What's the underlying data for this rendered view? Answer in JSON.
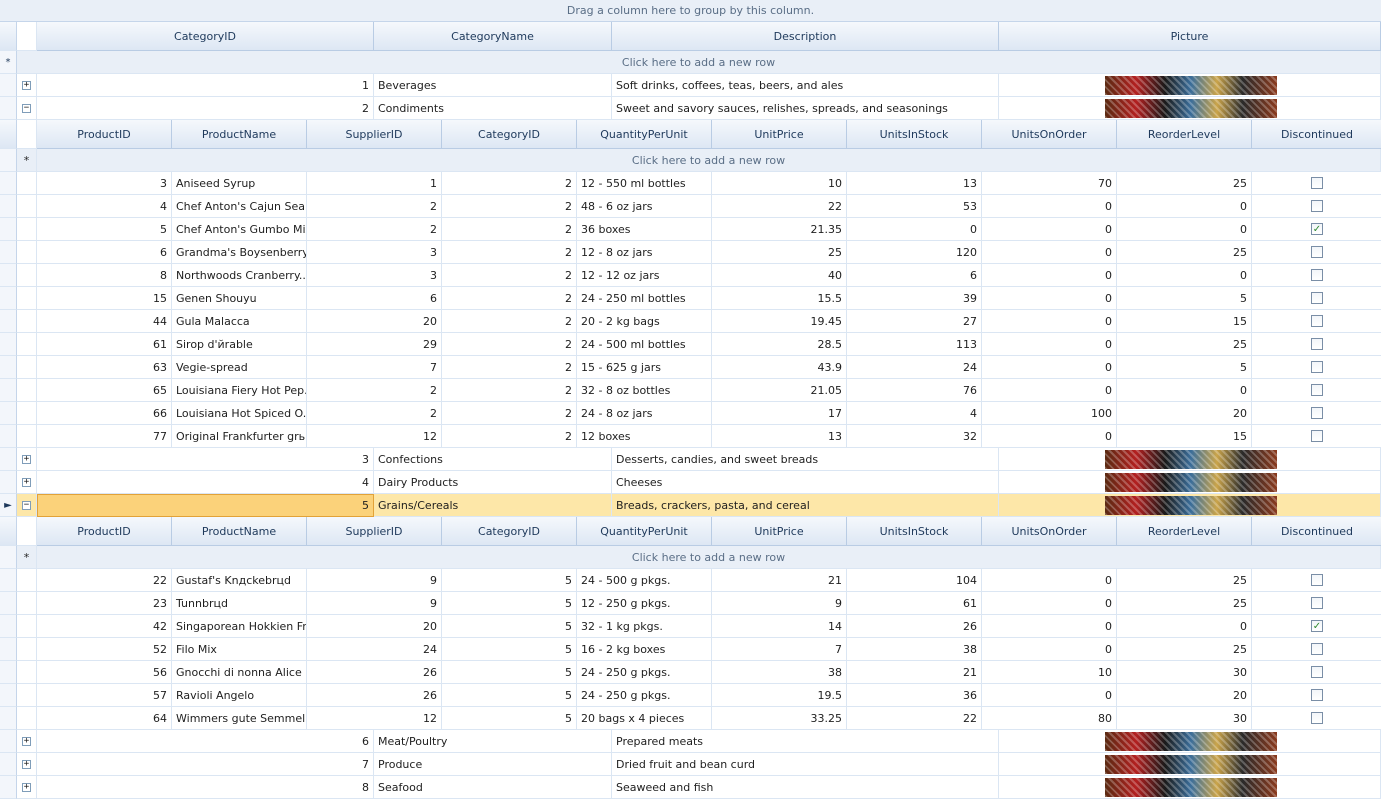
{
  "group_panel": "Drag a column here to group by this column.",
  "new_row_text": "Click here to add a new row",
  "new_row_icon": "*",
  "current_row_icon": "►",
  "master_columns": [
    "CategoryID",
    "CategoryName",
    "Description",
    "Picture"
  ],
  "detail_columns": [
    "ProductID",
    "ProductName",
    "SupplierID",
    "CategoryID",
    "QuantityPerUnit",
    "UnitPrice",
    "UnitsInStock",
    "UnitsOnOrder",
    "ReorderLevel",
    "Discontinued"
  ],
  "categories": [
    {
      "id": "1",
      "name": "Beverages",
      "description": "Soft drinks, coffees, teas, beers, and ales",
      "expanded": false
    },
    {
      "id": "2",
      "name": "Condiments",
      "description": "Sweet and savory sauces, relishes, spreads, and seasonings",
      "expanded": true
    },
    {
      "id": "3",
      "name": "Confections",
      "description": "Desserts, candies, and sweet breads",
      "expanded": false
    },
    {
      "id": "4",
      "name": "Dairy Products",
      "description": "Cheeses",
      "expanded": false
    },
    {
      "id": "5",
      "name": "Grains/Cereals",
      "description": "Breads, crackers, pasta, and cereal",
      "expanded": true,
      "selected": true
    },
    {
      "id": "6",
      "name": "Meat/Poultry",
      "description": "Prepared meats",
      "expanded": false
    },
    {
      "id": "7",
      "name": "Produce",
      "description": "Dried fruit and bean curd",
      "expanded": false
    },
    {
      "id": "8",
      "name": "Seafood",
      "description": "Seaweed and fish",
      "expanded": false
    }
  ],
  "condiments_products": [
    [
      "3",
      "Aniseed Syrup",
      "1",
      "2",
      "12 - 550 ml bottles",
      "10",
      "13",
      "70",
      "25",
      false
    ],
    [
      "4",
      "Chef Anton's Cajun Sea...",
      "2",
      "2",
      "48 - 6 oz jars",
      "22",
      "53",
      "0",
      "0",
      false
    ],
    [
      "5",
      "Chef Anton's Gumbo Mix",
      "2",
      "2",
      "36 boxes",
      "21.35",
      "0",
      "0",
      "0",
      true
    ],
    [
      "6",
      "Grandma's Boysenberry...",
      "3",
      "2",
      "12 - 8 oz jars",
      "25",
      "120",
      "0",
      "25",
      false
    ],
    [
      "8",
      "Northwoods Cranberry...",
      "3",
      "2",
      "12 - 12 oz jars",
      "40",
      "6",
      "0",
      "0",
      false
    ],
    [
      "15",
      "Genen Shouyu",
      "6",
      "2",
      "24 - 250 ml bottles",
      "15.5",
      "39",
      "0",
      "5",
      false
    ],
    [
      "44",
      "Gula Malacca",
      "20",
      "2",
      "20 - 2 kg bags",
      "19.45",
      "27",
      "0",
      "15",
      false
    ],
    [
      "61",
      "Sirop d'йrable",
      "29",
      "2",
      "24 - 500 ml bottles",
      "28.5",
      "113",
      "0",
      "25",
      false
    ],
    [
      "63",
      "Vegie-spread",
      "7",
      "2",
      "15 - 625 g jars",
      "43.9",
      "24",
      "0",
      "5",
      false
    ],
    [
      "65",
      "Louisiana Fiery Hot Pep...",
      "2",
      "2",
      "32 - 8 oz bottles",
      "21.05",
      "76",
      "0",
      "0",
      false
    ],
    [
      "66",
      "Louisiana Hot Spiced O...",
      "2",
      "2",
      "24 - 8 oz jars",
      "17",
      "4",
      "100",
      "20",
      false
    ],
    [
      "77",
      "Original Frankfurter grь...",
      "12",
      "2",
      "12 boxes",
      "13",
      "32",
      "0",
      "15",
      false
    ]
  ],
  "grains_products": [
    [
      "22",
      "Gustaf's Knдckebrцd",
      "9",
      "5",
      "24 - 500 g pkgs.",
      "21",
      "104",
      "0",
      "25",
      false
    ],
    [
      "23",
      "Tunnbrцd",
      "9",
      "5",
      "12 - 250 g pkgs.",
      "9",
      "61",
      "0",
      "25",
      false
    ],
    [
      "42",
      "Singaporean Hokkien Fr...",
      "20",
      "5",
      "32 - 1 kg pkgs.",
      "14",
      "26",
      "0",
      "0",
      true
    ],
    [
      "52",
      "Filo Mix",
      "24",
      "5",
      "16 - 2 kg boxes",
      "7",
      "38",
      "0",
      "25",
      false
    ],
    [
      "56",
      "Gnocchi di nonna Alice",
      "26",
      "5",
      "24 - 250 g pkgs.",
      "38",
      "21",
      "10",
      "30",
      false
    ],
    [
      "57",
      "Ravioli Angelo",
      "26",
      "5",
      "24 - 250 g pkgs.",
      "19.5",
      "36",
      "0",
      "20",
      false
    ],
    [
      "64",
      "Wimmers gute Semmel...",
      "12",
      "5",
      "20 bags x 4 pieces",
      "33.25",
      "22",
      "80",
      "30",
      false
    ]
  ],
  "colors": {
    "header": "#dde7f4",
    "selected_row": "#fde7a8",
    "new_row": "#e9eff7",
    "check": "#2f8a2f"
  }
}
